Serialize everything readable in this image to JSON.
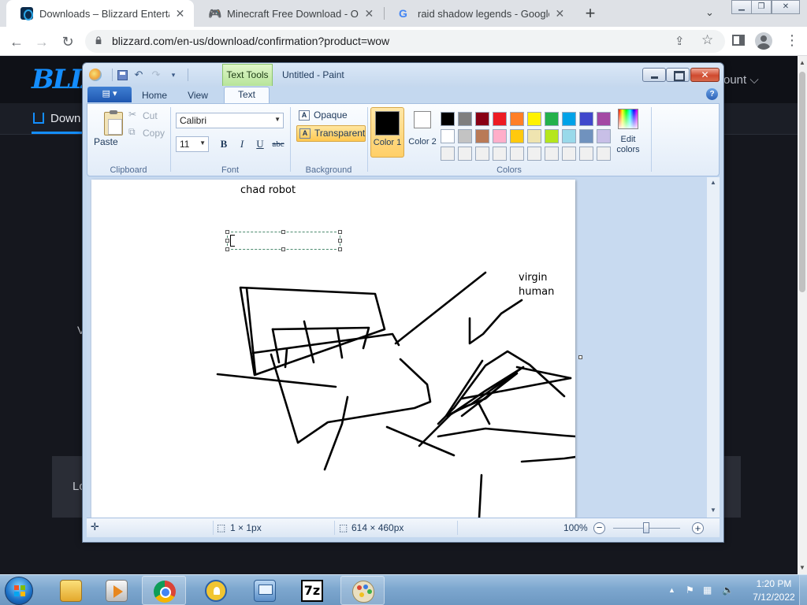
{
  "browser": {
    "tabs": [
      {
        "title": "Downloads – Blizzard Entertainment",
        "favicon": "blizzard-favicon",
        "active": true
      },
      {
        "title": "Minecraft Free Download - OceanofGames",
        "favicon": "gamepad-favicon",
        "active": false
      },
      {
        "title": "raid shadow legends - Google Search",
        "favicon": "google-favicon",
        "active": false
      }
    ],
    "new_tab": "+",
    "tab_search": "⌄",
    "close_glyph": "✕",
    "url": "blizzard.com/en-us/download/confirmation?product=wow"
  },
  "blizzard_page": {
    "logo": "BLIZZARD",
    "account": "ount ⌵",
    "downloads_link": "Down",
    "card_text": "Lo",
    "left_glyph": "V"
  },
  "paint": {
    "contextual_tab": "Text Tools",
    "title": "Untitled - Paint",
    "tabs": {
      "home": "Home",
      "view": "View",
      "text": "Text"
    },
    "help": "?",
    "clipboard": {
      "paste": "Paste",
      "cut": "Cut",
      "copy": "Copy",
      "group": "Clipboard"
    },
    "font": {
      "family": "Calibri",
      "size": "11",
      "bold": "B",
      "italic": "I",
      "underline": "U",
      "strike": "abc",
      "group": "Font"
    },
    "background": {
      "opaque": "Opaque",
      "transparent": "Transparent",
      "group": "Background",
      "selected": "transparent"
    },
    "colors": {
      "color1_label": "Color 1",
      "color2_label": "Color 2",
      "edit_label": "Edit colors",
      "group": "Colors",
      "color1": "#000000",
      "color2": "#ffffff",
      "palette_row1": [
        "#000000",
        "#7f7f7f",
        "#880015",
        "#ed1c24",
        "#ff7f27",
        "#fff200",
        "#22b14c",
        "#00a2e8",
        "#3f48cc",
        "#a349a4"
      ],
      "palette_row2": [
        "#ffffff",
        "#c3c3c3",
        "#b97a57",
        "#ffaec9",
        "#ffc90e",
        "#efe4b0",
        "#b5e61d",
        "#99d9ea",
        "#7092be",
        "#c8bfe7"
      ],
      "palette_row3": [
        "#f0f0f0",
        "#f0f0f0",
        "#f0f0f0",
        "#f0f0f0",
        "#f0f0f0",
        "#f0f0f0",
        "#f0f0f0",
        "#f0f0f0",
        "#f0f0f0",
        "#f0f0f0"
      ]
    },
    "canvas": {
      "text_chad": "chad robot",
      "text_virgin": "virgin human"
    },
    "status": {
      "selection": "1 × 1px",
      "image_size": "614 × 460px",
      "zoom": "100%",
      "zoom_value": 100
    }
  },
  "taskbar": {
    "apps": [
      "windows-explorer",
      "media-player",
      "google-chrome",
      "keepass",
      "remote-desktop",
      "7-zip",
      "paint"
    ],
    "seven_zip": "7z",
    "time": "1:20 PM",
    "date": "7/12/2022"
  }
}
